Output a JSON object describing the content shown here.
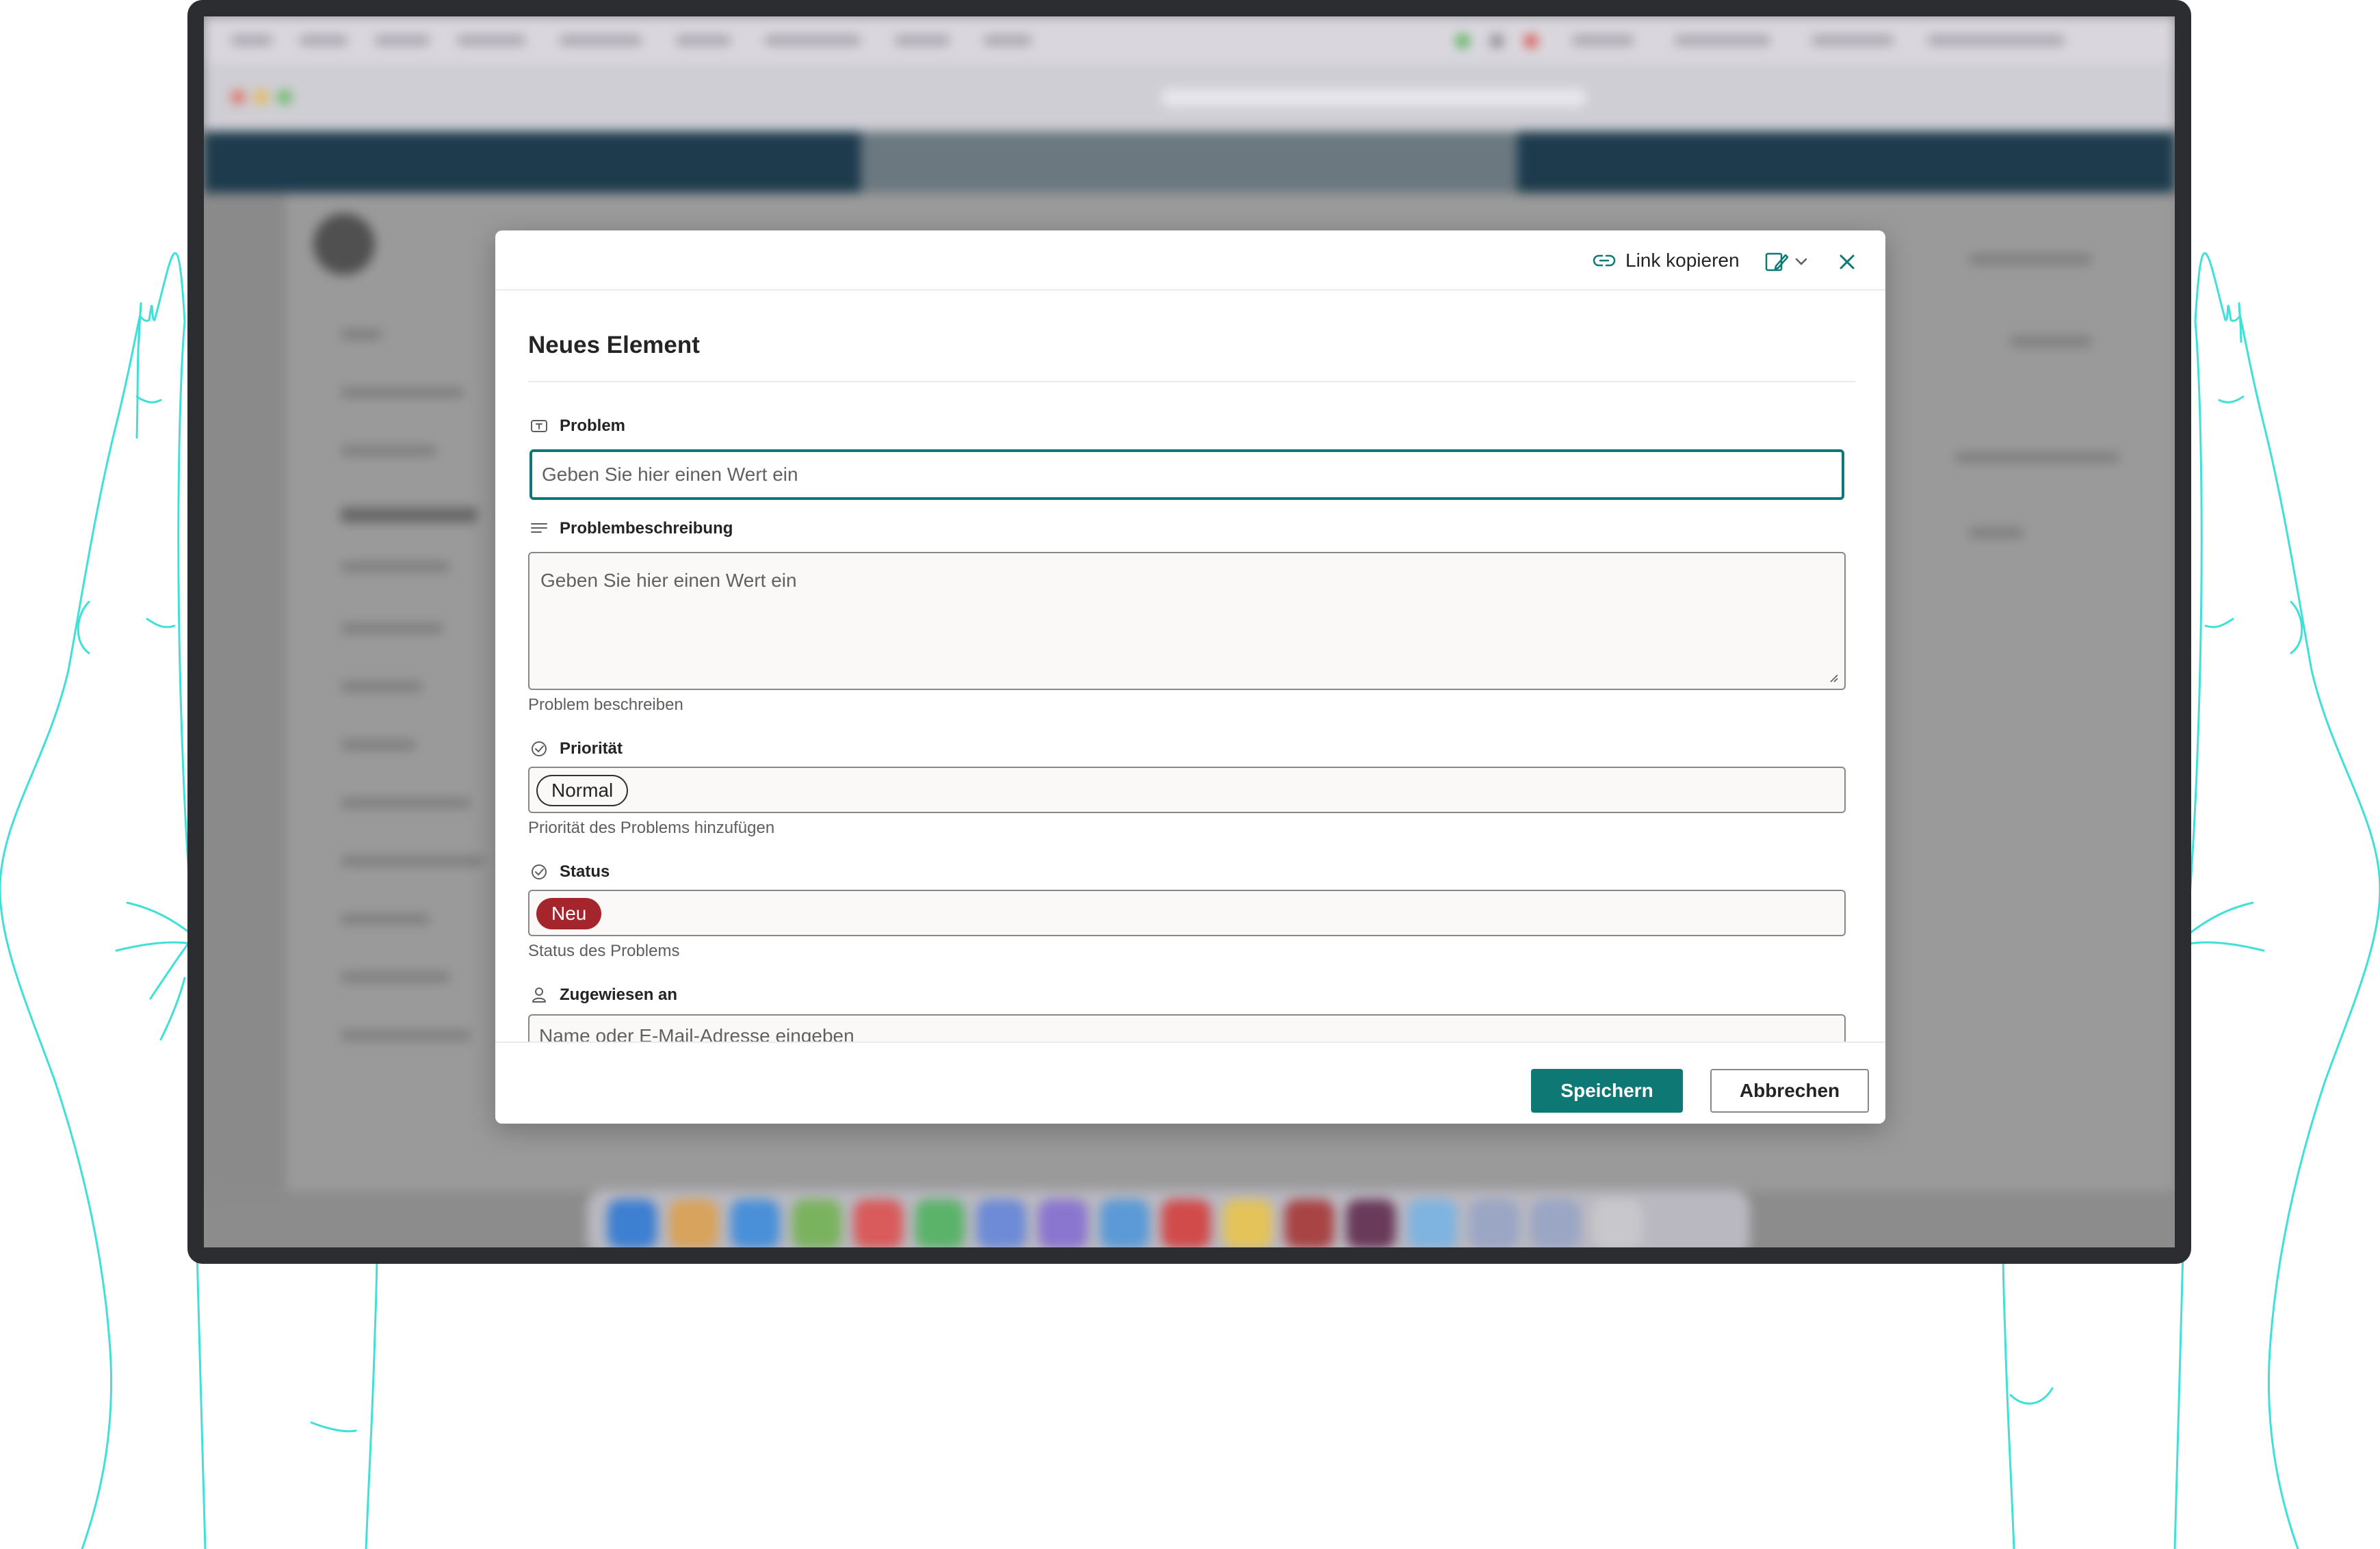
{
  "dialog": {
    "toolbar": {
      "copy_link_label": "Link kopieren"
    },
    "title": "Neues Element",
    "fields": {
      "problem": {
        "label": "Problem",
        "placeholder": "Geben Sie hier einen Wert ein",
        "value": ""
      },
      "description": {
        "label": "Problembeschreibung",
        "placeholder": "Geben Sie hier einen Wert ein",
        "hint": "Problem beschreiben"
      },
      "priority": {
        "label": "Priorität",
        "value": "Normal",
        "hint": "Priorität des Problems hinzufügen"
      },
      "status": {
        "label": "Status",
        "value": "Neu",
        "value_color": "#a4262c",
        "hint": "Status des Problems"
      },
      "assigned_to": {
        "label": "Zugewiesen an",
        "placeholder": "Name oder E-Mail-Adresse eingeben"
      }
    },
    "footer": {
      "save_label": "Speichern",
      "cancel_label": "Abbrechen"
    }
  },
  "colors": {
    "accent": "#0e7874",
    "status_new": "#a4262c",
    "hand_outline": "#3fe0d8",
    "device_frame": "#2b2d31"
  },
  "icons": {
    "copy_link": "link-icon",
    "view_switch": "edit-form-icon",
    "close": "close-icon",
    "text_field": "text-field-icon",
    "multiline": "multiline-text-icon",
    "choice": "choice-check-icon",
    "person": "person-icon"
  }
}
